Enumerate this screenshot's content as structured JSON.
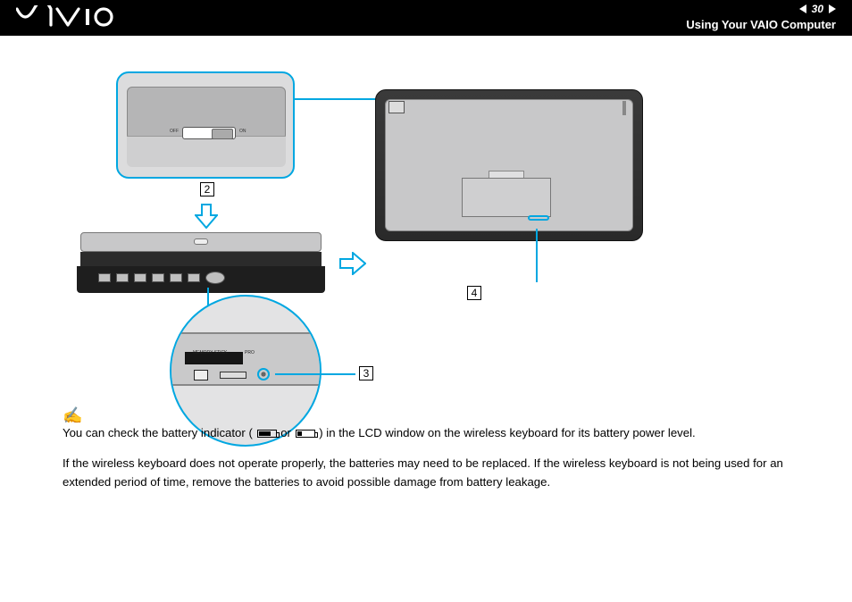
{
  "header": {
    "logo": "VAIO",
    "page_number": "30",
    "section_title": "Using Your VAIO Computer"
  },
  "diagram": {
    "ref2": "2",
    "ref3": "3",
    "ref4": "4",
    "switch_off": "OFF",
    "switch_on": "ON",
    "detail_label_ms": "MEMORY STICK",
    "detail_label_pro": "PRO"
  },
  "body": {
    "note_line_a": "You can check the battery indicator (",
    "note_or": " or ",
    "note_line_b": ") in the LCD window on the wireless keyboard for its battery power level.",
    "para2": "If the wireless keyboard does not operate properly, the batteries may need to be replaced. If the wireless keyboard is not being used for an extended period of time, remove the batteries to avoid possible damage from battery leakage."
  }
}
